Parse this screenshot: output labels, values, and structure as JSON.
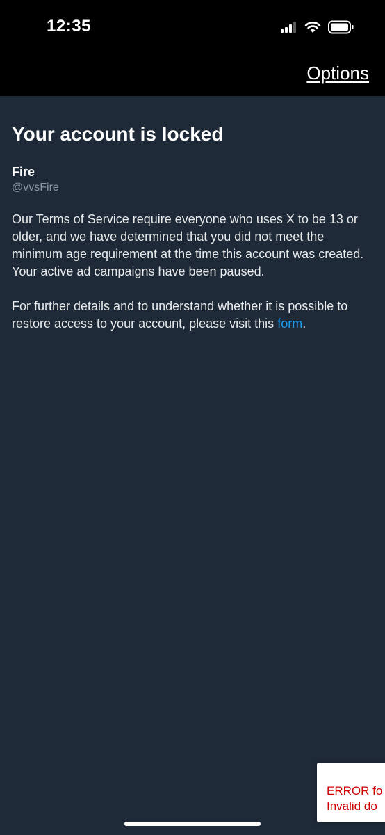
{
  "status_bar": {
    "time": "12:35",
    "icons": [
      "cellular-signal-icon",
      "wifi-icon",
      "battery-icon"
    ]
  },
  "header": {
    "options_label": "Options"
  },
  "locked": {
    "title": "Your account is locked",
    "display_name": "Fire",
    "handle": "@vvsFire",
    "paragraph1": "Our Terms of Service require everyone who uses X to be 13 or older, and we have determined that you did not meet the minimum age requirement at the time this account was created.",
    "paragraph2": "Your active ad campaigns have been paused.",
    "paragraph3_prefix": "For further details and to understand whether it is possible to restore access to your account, please visit this ",
    "form_link": "form",
    "paragraph3_suffix": "."
  },
  "error_toast": {
    "line1": "ERROR fo",
    "line2": "Invalid do"
  },
  "colors": {
    "background": "#1e2a37",
    "top_bar": "#000000",
    "link": "#1d9bf0",
    "handle": "#8b98a5",
    "error_text": "#d00000"
  }
}
